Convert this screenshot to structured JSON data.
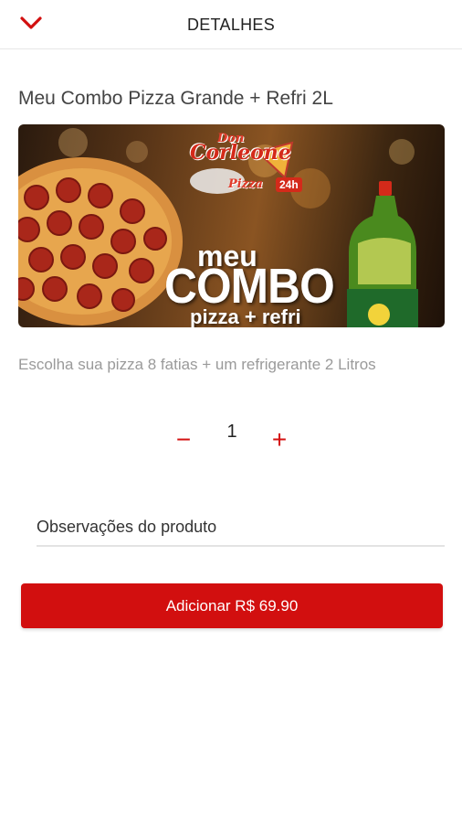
{
  "header": {
    "title": "DETALHES",
    "back_icon": "chevron-down-icon"
  },
  "product": {
    "name": "Meu Combo Pizza Grande + Refri 2L",
    "description": "Escolha sua pizza 8 fatias + um refrigerante 2 Litros",
    "banner": {
      "brand_line1": "Don",
      "brand_line2": "Corleone",
      "brand_line3": "Pizza",
      "brand_badge": "24h",
      "headline_small": "meu",
      "headline_big": "COMBO",
      "headline_sub": "pizza + refri"
    }
  },
  "quantity": {
    "value": "1",
    "minus_symbol": "−",
    "plus_symbol": "+"
  },
  "observations": {
    "placeholder": "Observações do produto"
  },
  "add_button": {
    "label": "Adicionar R$ 69.90"
  },
  "colors": {
    "accent": "#d20f0f",
    "muted_text": "#9a9a9a",
    "divider": "#e3e3e3"
  }
}
